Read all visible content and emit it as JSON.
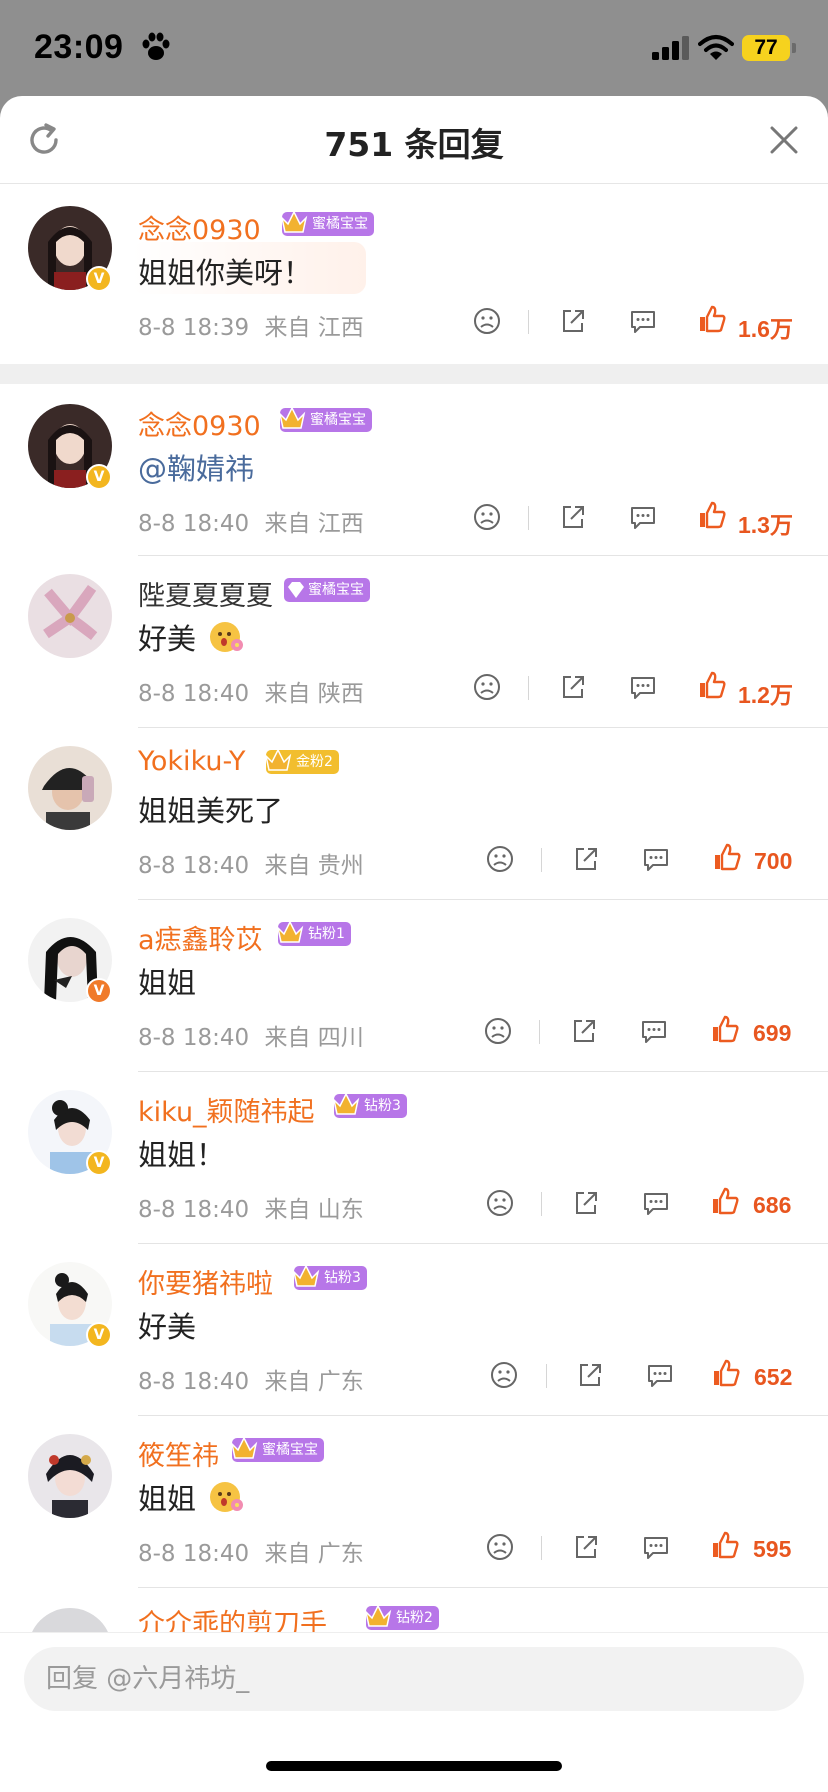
{
  "status_bar": {
    "time": "23:09",
    "battery": "77",
    "icons": [
      "paw-icon",
      "signal-icon",
      "wifi-icon",
      "battery-icon"
    ]
  },
  "header": {
    "title": "751 条回复",
    "icons": [
      "refresh-icon",
      "close-icon"
    ]
  },
  "comments": [
    {
      "user": "念念0930",
      "badge": "蜜橘宝宝",
      "text": "姐姐你美呀！",
      "time": "8-8 18:39",
      "location": "来自 江西",
      "likes": "1.6万"
    },
    {
      "user": "念念0930",
      "badge": "蜜橘宝宝",
      "mention": "@鞠婧祎",
      "time": "8-8 18:40",
      "location": "来自 江西",
      "likes": "1.3万"
    },
    {
      "user": "陛夏夏夏夏",
      "badge": "蜜橘宝宝",
      "text": "好美",
      "time": "8-8 18:40",
      "location": "来自 陕西",
      "likes": "1.2万"
    },
    {
      "user": "Yokiku-Y",
      "badge": "金粉2",
      "text": "姐姐美死了",
      "time": "8-8 18:40",
      "location": "来自 贵州",
      "likes": "700"
    },
    {
      "user": "a痣鑫聆苡",
      "badge": "钻粉1",
      "text": "姐姐",
      "time": "8-8 18:40",
      "location": "来自 四川",
      "likes": "699"
    },
    {
      "user": "kiku_颖随祎起",
      "badge": "钻粉3",
      "text": "姐姐！",
      "time": "8-8 18:40",
      "location": "来自 山东",
      "likes": "686"
    },
    {
      "user": "你要猪祎啦",
      "badge": "钻粉3",
      "text": "好美",
      "time": "8-8 18:40",
      "location": "来自 广东",
      "likes": "652"
    },
    {
      "user": "筱笙祎",
      "badge": "蜜橘宝宝",
      "text": "姐姐",
      "time": "8-8 18:40",
      "location": "来自 广东",
      "likes": "595"
    },
    {
      "user": "介介乖的剪刀手",
      "badge": "钻粉2"
    }
  ],
  "actions": [
    "dislike-icon",
    "share-icon",
    "comment-icon",
    "like-icon"
  ],
  "reply": {
    "placeholder": "回复 @六月祎坊_"
  },
  "colors": {
    "username": "#f1701f",
    "likes": "#e8561f",
    "mention": "#4a6b9c",
    "vip_badge": "#f3b61f",
    "badge_purple": "#b776e8",
    "badge_gold": "#f2be2e"
  }
}
